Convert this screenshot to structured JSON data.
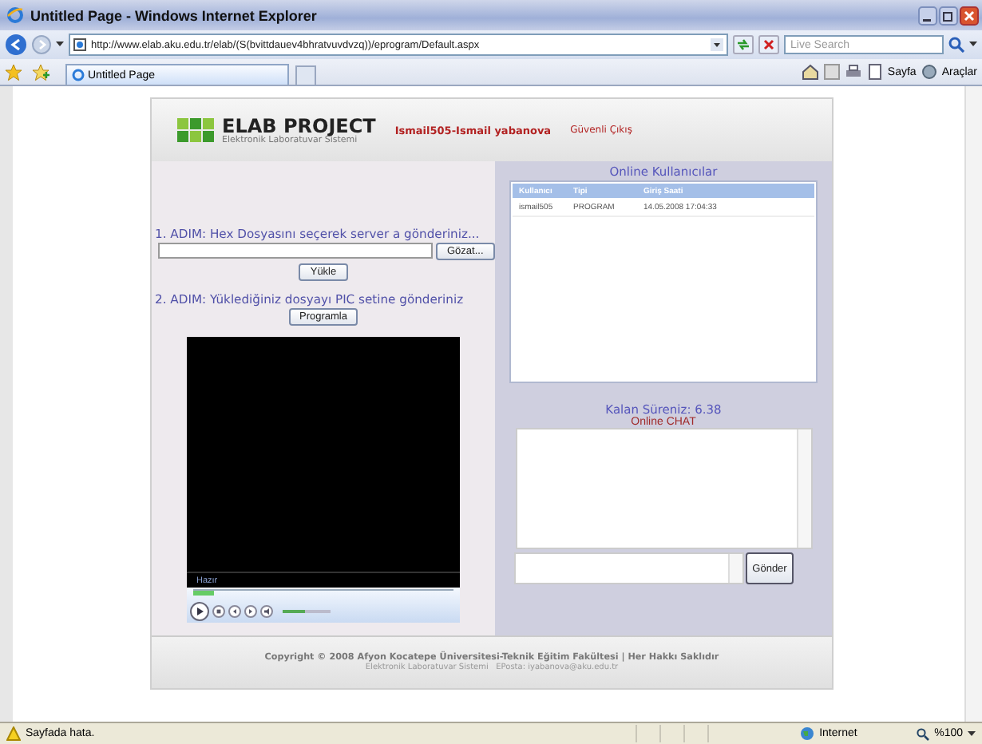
{
  "window": {
    "title": "Untitled Page - Windows Internet Explorer"
  },
  "address_bar": {
    "url": "http://www.elab.aku.edu.tr/elab/(S(bvittdauev4bhratvuvdvzq))/eprogram/Default.aspx",
    "search_placeholder": "Live Search"
  },
  "tabs": [
    {
      "label": "Untitled Page",
      "selected": true
    }
  ],
  "toolbar": {
    "items": [
      "Sayfa",
      "Araçlar"
    ]
  },
  "header": {
    "logo_title": "ELAB PROJECT",
    "logo_subtitle": "Elektronik Laboratuvar Sistemi",
    "user": "Ismail505-Ismail yabanova",
    "logout": "Güvenli Çıkış"
  },
  "upload": {
    "step1": "1. ADIM: Hex Dosyasını seçerek server a gönderiniz...",
    "browse_button": "Gözat...",
    "upload_button": "Yükle",
    "step2": "2. ADIM: Yüklediğiniz dosyayı PIC setine gönderiniz",
    "program_button": "Programla"
  },
  "player": {
    "status": "Hazır",
    "seek": {
      "level": 0.08
    },
    "volume": {
      "level": 0.45
    }
  },
  "online_users": {
    "title": "Online Kullanıcılar",
    "columns": [
      "Kullanıcı",
      "Tipi",
      "Giriş Saati"
    ],
    "rows": [
      [
        "ismail505",
        "PROGRAM",
        "14.05.2008 17:04:33"
      ]
    ]
  },
  "remaining_time": "Kalan Süreniz: 6.38",
  "chat": {
    "title": "Online CHAT",
    "send_button": "Gönder"
  },
  "footer": {
    "copyright": "Copyright © 2008 Afyon Kocatepe Üniversitesi-Teknik Eğitim Fakültesi | Her Hakkı Saklıdır",
    "contact": "Elektronik Laboratuvar Sistemi   EPosta: iyabanova@aku.edu.tr"
  },
  "status_bar": {
    "message": "Sayfada hata.",
    "zone": "Internet",
    "zoom": "%100"
  }
}
